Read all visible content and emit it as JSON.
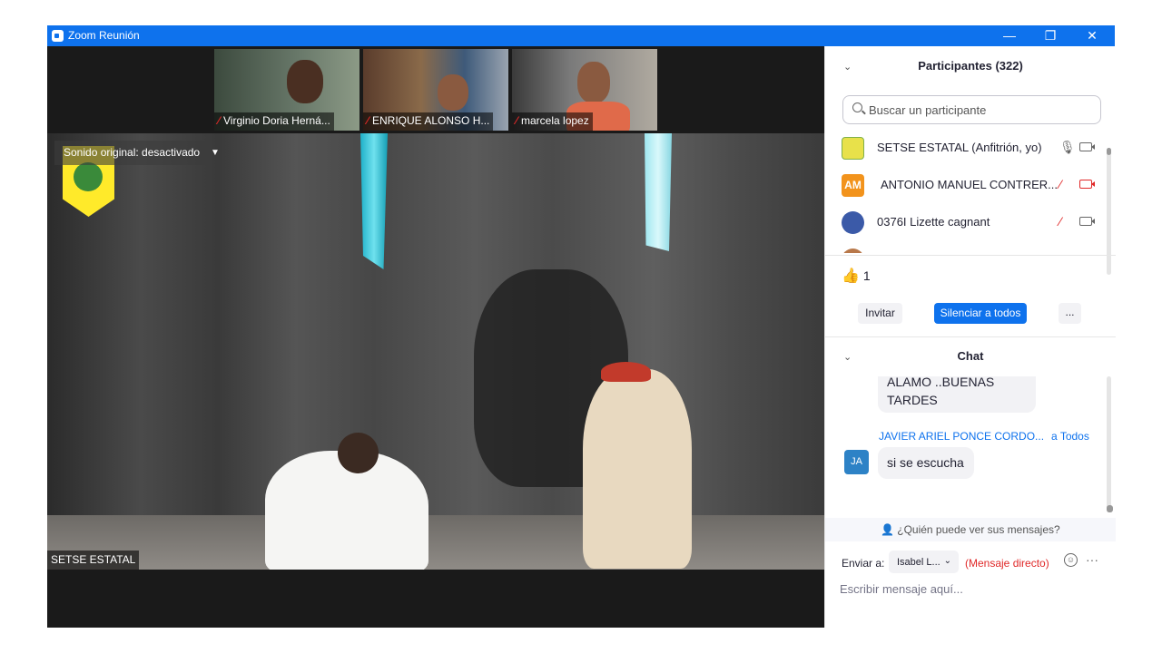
{
  "window": {
    "title": "Zoom Reunión",
    "minimize_glyph": "—",
    "maximize_glyph": "❐",
    "close_glyph": "✕"
  },
  "video": {
    "sound_label": "Sonido original: desactivado",
    "active_speaker": "SETSE ESTATAL",
    "thumbnails": [
      {
        "name": "Virginio Doria Herná...",
        "mic": "muted"
      },
      {
        "name": "ENRIQUE ALONSO H...",
        "mic": "muted"
      },
      {
        "name": "marcela lopez",
        "mic": "muted"
      }
    ]
  },
  "participants": {
    "title": "Participantes (322)",
    "search_placeholder": "Buscar un participante",
    "list": [
      {
        "name": "SETSE ESTATAL (Anfitrión, yo)",
        "initials": "",
        "avatar_color": "#e8e14a",
        "mic": "on",
        "video": "on"
      },
      {
        "name": "ANTONIO MANUEL CONTRER...",
        "initials": "AM",
        "avatar_color": "#f2931c",
        "mic": "muted",
        "video": "off"
      },
      {
        "name": "0376I Lizette cagnant",
        "initials": "",
        "avatar_color": "#3b5aa8",
        "mic": "muted",
        "video": "on"
      },
      {
        "name": "",
        "initials": "",
        "avatar_color": "#b8784a",
        "mic": "muted",
        "video": "on"
      }
    ],
    "reaction_count": "1",
    "invite_label": "Invitar",
    "mute_all_label": "Silenciar a todos",
    "more_label": "..."
  },
  "chat": {
    "title": "Chat",
    "messages": [
      {
        "sender": "",
        "text": "ALAMO ..BUENAS TARDES"
      },
      {
        "sender": "JAVIER ARIEL PONCE CORDO...",
        "to": "a Todos",
        "initials": "JA",
        "text": "si se escucha"
      }
    ],
    "who_sees": "¿Quién puede ver sus mensajes?",
    "send_to_label": "Enviar a:",
    "recipient": "Isabel L...",
    "direct_message": "(Mensaje directo)",
    "input_placeholder": "Escribir mensaje aquí..."
  },
  "colors": {
    "accent": "#0e72ed",
    "muted": "#e02828"
  }
}
